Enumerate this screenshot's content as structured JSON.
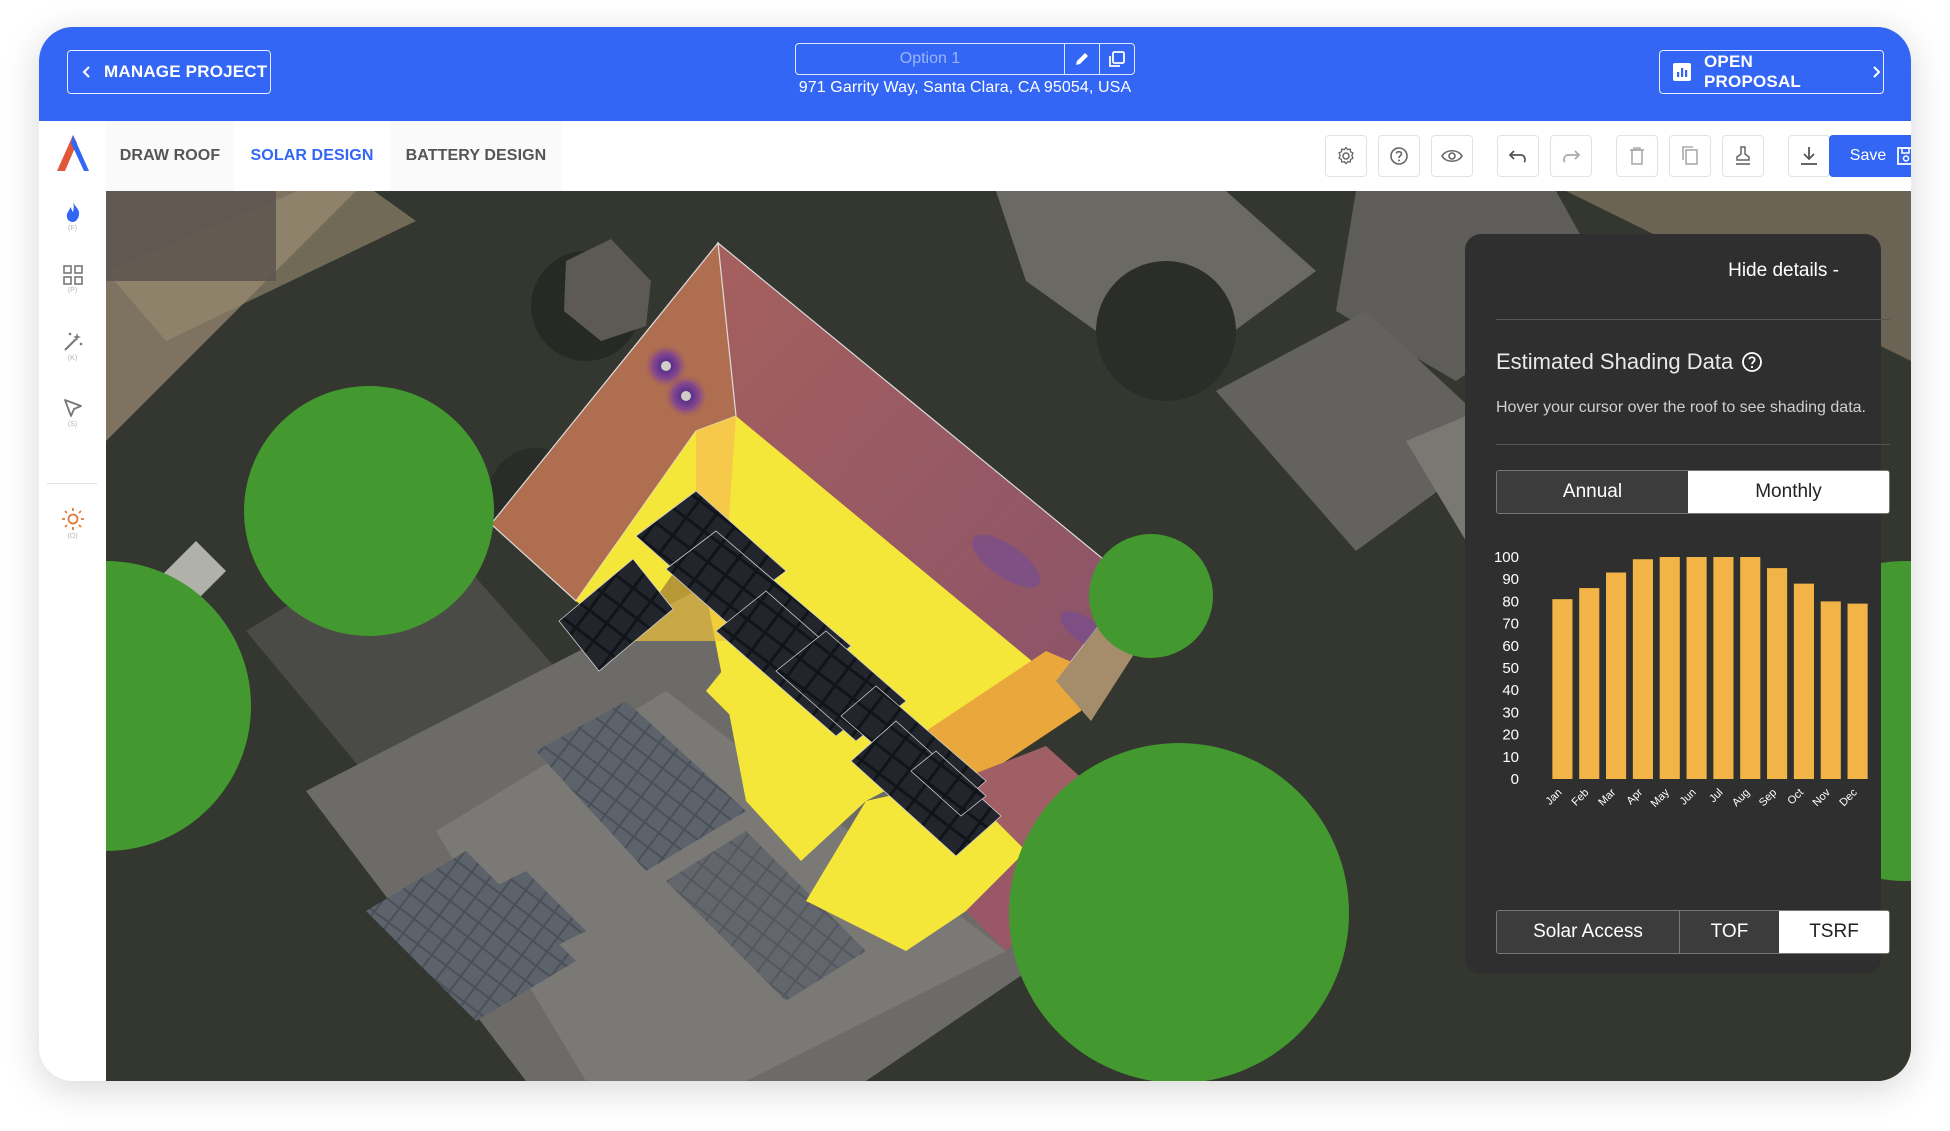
{
  "topbar": {
    "manage_label": "MANAGE PROJECT",
    "option_placeholder": "Option 1",
    "address": "971 Garrity Way, Santa Clara, CA 95054, USA",
    "open_proposal_label": "OPEN PROPOSAL",
    "accent": "#3366f5"
  },
  "tabs": [
    "DRAW ROOF",
    "SOLAR DESIGN",
    "BATTERY DESIGN"
  ],
  "active_tab": "SOLAR DESIGN",
  "toolbar": {
    "icons": [
      "gear-icon",
      "help-icon",
      "eye-icon",
      "undo-icon",
      "redo-icon",
      "trash-icon",
      "copy-icon",
      "stamp-icon",
      "download-icon"
    ],
    "save_label": "Save"
  },
  "rail": {
    "items": [
      {
        "icon": "fire-icon",
        "key": "(F)"
      },
      {
        "icon": "grid-icon",
        "key": "(P)"
      },
      {
        "icon": "magic-wand-icon",
        "key": "(K)"
      },
      {
        "icon": "select-arrow-icon",
        "key": "(S)"
      },
      {
        "icon": "sun-icon",
        "key": "(O)"
      }
    ]
  },
  "panel": {
    "hide_label": "Hide details -",
    "title": "Estimated Shading Data",
    "hint": "Hover your cursor over the roof to see shading data.",
    "period_tabs": [
      "Annual",
      "Monthly"
    ],
    "period_selected": "Monthly",
    "metric_tabs": [
      "Solar Access",
      "TOF",
      "TSRF"
    ],
    "metric_selected": "TSRF"
  },
  "chart_data": {
    "type": "bar",
    "categories": [
      "Jan",
      "Feb",
      "Mar",
      "Apr",
      "May",
      "Jun",
      "Jul",
      "Aug",
      "Sep",
      "Oct",
      "Nov",
      "Dec"
    ],
    "values": [
      81,
      86,
      93,
      99,
      100,
      100,
      100,
      100,
      95,
      88,
      80,
      79
    ],
    "ylim": [
      0,
      100
    ],
    "yticks": [
      100,
      90,
      80,
      70,
      60,
      50,
      40,
      30,
      20,
      10,
      0
    ],
    "bar_color": "#f3b447"
  }
}
